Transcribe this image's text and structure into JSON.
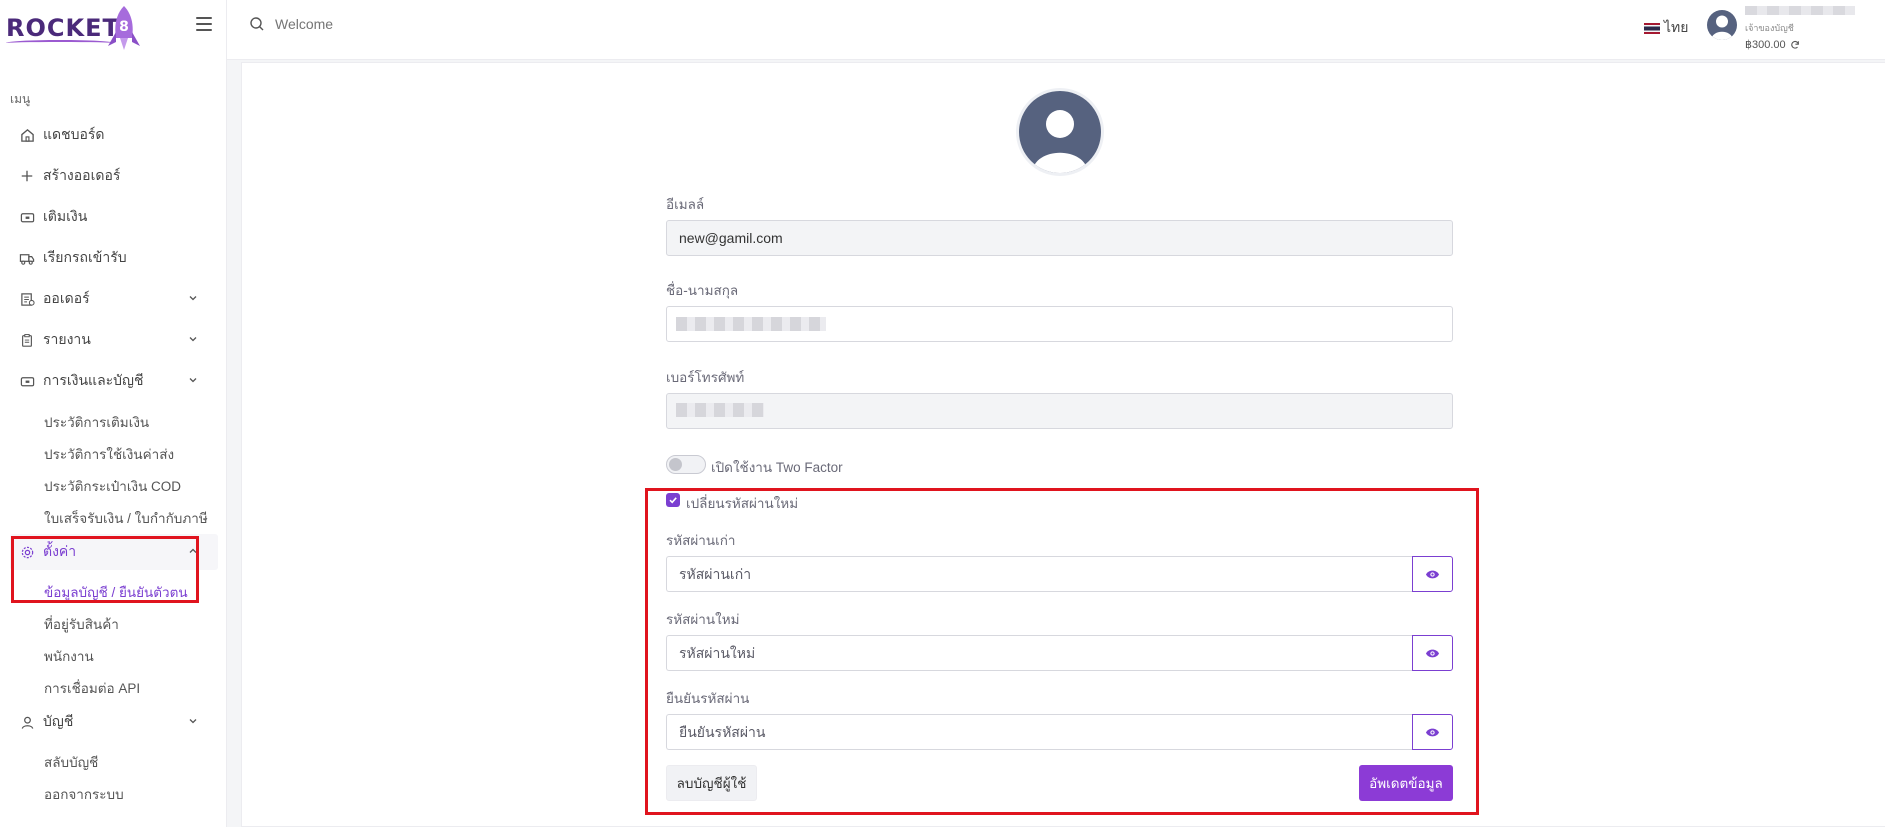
{
  "brand": {
    "name": "ROCKET",
    "number": "8"
  },
  "sidebar": {
    "heading": "เมนู",
    "items": [
      {
        "label": "แดชบอร์ด",
        "icon": "home-icon"
      },
      {
        "label": "สร้างออเดอร์",
        "icon": "plus-icon"
      },
      {
        "label": "เติมเงิน",
        "icon": "wallet-icon"
      },
      {
        "label": "เรียกรถเข้ารับ",
        "icon": "truck-icon"
      },
      {
        "label": "ออเดอร์",
        "icon": "orders-icon"
      },
      {
        "label": "รายงาน",
        "icon": "clipboard-icon"
      },
      {
        "label": "การเงินและบัญชี",
        "icon": "money-icon"
      },
      {
        "label": "ตั้งค่า",
        "icon": "gear-icon"
      },
      {
        "label": "บัญชี",
        "icon": "user-icon"
      }
    ],
    "finance_sub": [
      "ประวัติการเติมเงิน",
      "ประวัติการใช้เงินค่าส่ง",
      "ประวัติกระเป๋าเงิน COD",
      "ใบเสร็จรับเงิน / ใบกำกับภาษี"
    ],
    "settings_sub": [
      "ข้อมูลบัญชี / ยืนยันตัวตน",
      "ที่อยู่รับสินค้า",
      "พนักงาน",
      "การเชื่อมต่อ API"
    ],
    "account_sub": [
      "สลับบัญชี",
      "ออกจากระบบ"
    ]
  },
  "topbar": {
    "search_placeholder": "Welcome",
    "language": "ไทย",
    "user_role": "เจ้าของบัญชี",
    "balance": "฿300.00"
  },
  "form": {
    "email_label": "อีเมลล์",
    "email_value": "new@gamil.com",
    "name_label": "ชื่อ-นามสกุล",
    "phone_label": "เบอร์โทรศัพท์",
    "two_factor_label": "เปิดใช้งาน Two Factor",
    "two_factor_enabled": false,
    "change_password_label": "เปลี่ยนรหัสผ่านใหม่",
    "change_password_checked": true,
    "old_password_label": "รหัสผ่านเก่า",
    "old_password_placeholder": "รหัสผ่านเก่า",
    "new_password_label": "รหัสผ่านใหม่",
    "new_password_placeholder": "รหัสผ่านใหม่",
    "confirm_password_label": "ยืนยันรหัสผ่าน",
    "confirm_password_placeholder": "ยืนยันรหัสผ่าน",
    "delete_button": "ลบบัญชีผู้ใช้",
    "update_button": "อัพเดตข้อมูล"
  },
  "colors": {
    "accent": "#8c3bd6",
    "highlight": "#e0141e"
  }
}
